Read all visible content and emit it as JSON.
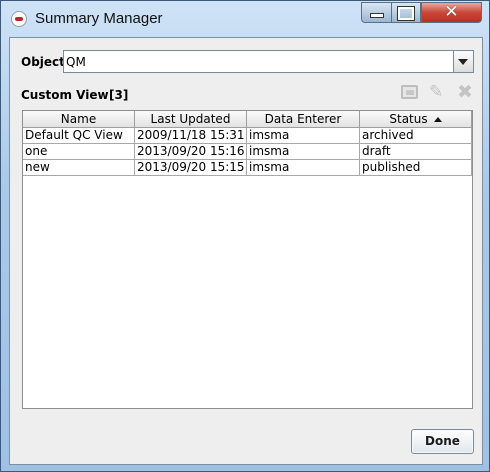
{
  "window": {
    "title": "Summary Manager",
    "controls": {
      "minimize": "minimize",
      "maximize": "maximize",
      "close": "close"
    }
  },
  "object": {
    "label": "Object",
    "value": "QM"
  },
  "custom_view": {
    "label": "Custom View",
    "count": "[3]",
    "tools": [
      "view-icon",
      "edit-icon",
      "delete-icon"
    ]
  },
  "table": {
    "columns": [
      "Name",
      "Last Updated",
      "Data Enterer",
      "Status"
    ],
    "sorted_column": "Status",
    "sort_direction": "ascending",
    "rows": [
      {
        "name": "Default QC View",
        "last_updated": "2009/11/18 15:31",
        "data_enterer": "imsma",
        "status": "archived"
      },
      {
        "name": "one",
        "last_updated": "2013/09/20 15:16",
        "data_enterer": "imsma",
        "status": "draft"
      },
      {
        "name": "new",
        "last_updated": "2013/09/20 15:15",
        "data_enterer": "imsma",
        "status": "published"
      }
    ]
  },
  "footer": {
    "done_label": "Done"
  }
}
